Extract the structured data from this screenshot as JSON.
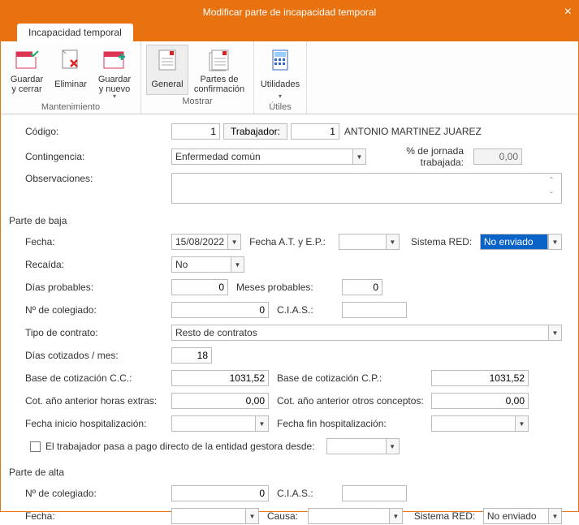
{
  "window": {
    "title": "Modificar parte de incapacidad temporal",
    "tab": "Incapacidad temporal"
  },
  "ribbon": {
    "groups": {
      "mantenimiento": {
        "label": "Mantenimiento",
        "buttons": {
          "guardar_cerrar": "Guardar\ny cerrar",
          "eliminar": "Eliminar",
          "guardar_nuevo": "Guardar\ny nuevo"
        }
      },
      "mostrar": {
        "label": "Mostrar",
        "buttons": {
          "general": "General",
          "partes_confirmacion": "Partes de\nconfirmación"
        }
      },
      "utiles": {
        "label": "Útiles",
        "buttons": {
          "utilidades": "Utilidades"
        }
      }
    }
  },
  "general": {
    "codigo_label": "Código:",
    "codigo_value": "1",
    "trabajador_btn": "Trabajador:",
    "trabajador_code": "1",
    "trabajador_name": "ANTONIO MARTINEZ JUAREZ",
    "contingencia_label": "Contingencia:",
    "contingencia_value": "Enfermedad común",
    "pct_jornada_label": "% de jornada trabajada:",
    "pct_jornada_value": "0,00",
    "observaciones_label": "Observaciones:"
  },
  "baja": {
    "section": "Parte de baja",
    "fecha_label": "Fecha:",
    "fecha_value": "15/08/2022",
    "fecha_at_ep_label": "Fecha A.T. y E.P.:",
    "fecha_at_ep_value": "",
    "sistema_red_label": "Sistema RED:",
    "sistema_red_value": "No enviado",
    "recaida_label": "Recaída:",
    "recaida_value": "No",
    "dias_probables_label": "Días probables:",
    "dias_probables_value": "0",
    "meses_probables_label": "Meses probables:",
    "meses_probables_value": "0",
    "n_colegiado_label": "Nº de colegiado:",
    "n_colegiado_value": "0",
    "cias_label": "C.I.A.S.:",
    "cias_value": "",
    "tipo_contrato_label": "Tipo de contrato:",
    "tipo_contrato_value": "Resto de contratos",
    "dias_cotizados_label": "Días cotizados / mes:",
    "dias_cotizados_value": "18",
    "base_cc_label": "Base de cotización C.C.:",
    "base_cc_value": "1031,52",
    "base_cp_label": "Base de cotización C.P.:",
    "base_cp_value": "1031,52",
    "cot_he_label": "Cot. año anterior horas extras:",
    "cot_he_value": "0,00",
    "cot_oc_label": "Cot. año anterior otros conceptos:",
    "cot_oc_value": "0,00",
    "hosp_ini_label": "Fecha inicio hospitalización:",
    "hosp_ini_value": "",
    "hosp_fin_label": "Fecha fin hospitalización:",
    "hosp_fin_value": "",
    "pago_directo_label": "El trabajador pasa a pago directo de la entidad gestora desde:",
    "pago_directo_value": ""
  },
  "alta": {
    "section": "Parte de alta",
    "n_colegiado_label": "Nº de colegiado:",
    "n_colegiado_value": "0",
    "cias_label": "C.I.A.S.:",
    "cias_value": "",
    "fecha_label": "Fecha:",
    "fecha_value": "",
    "causa_label": "Causa:",
    "causa_value": "",
    "sistema_red_label": "Sistema RED:",
    "sistema_red_value": "No enviado"
  }
}
